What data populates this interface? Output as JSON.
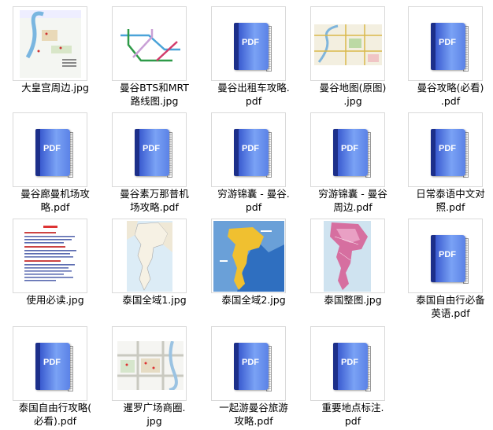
{
  "files": [
    {
      "name": "大皇宫周边.jpg",
      "kind": "image",
      "theme": "map-light"
    },
    {
      "name": "曼谷BTS和MRT\n路线图.jpg",
      "kind": "image",
      "theme": "transit"
    },
    {
      "name": "曼谷出租车攻略.\npdf",
      "kind": "pdf"
    },
    {
      "name": "曼谷地图(原图)\n.jpg",
      "kind": "image",
      "theme": "city-map"
    },
    {
      "name": "曼谷攻略(必看)\n.pdf",
      "kind": "pdf"
    },
    {
      "name": "曼谷廊曼机场攻\n略.pdf",
      "kind": "pdf"
    },
    {
      "name": "曼谷素万那普机\n场攻略.pdf",
      "kind": "pdf"
    },
    {
      "name": "穷游锦囊 - 曼谷.\npdf",
      "kind": "pdf"
    },
    {
      "name": "穷游锦囊 - 曼谷\n周边.pdf",
      "kind": "pdf"
    },
    {
      "name": "日常泰语中文对\n照.pdf",
      "kind": "pdf"
    },
    {
      "name": "使用必读.jpg",
      "kind": "image",
      "theme": "document"
    },
    {
      "name": "泰国全域1.jpg",
      "kind": "image",
      "theme": "country-light"
    },
    {
      "name": "泰国全域2.jpg",
      "kind": "image",
      "theme": "country-blue"
    },
    {
      "name": "泰国整图.jpg",
      "kind": "image",
      "theme": "country-pink"
    },
    {
      "name": "泰国自由行必备\n英语.pdf",
      "kind": "pdf"
    },
    {
      "name": "泰国自由行攻略(\n必看).pdf",
      "kind": "pdf"
    },
    {
      "name": "暹罗广场商圈.\njpg",
      "kind": "image",
      "theme": "street-map"
    },
    {
      "name": "一起游曼谷旅游\n攻略.pdf",
      "kind": "pdf"
    },
    {
      "name": "重要地点标注.\npdf",
      "kind": "pdf"
    }
  ],
  "pdf_badge": "PDF",
  "colors": {
    "pdf_dark": "#1c2f8a",
    "pdf_light": "#7aa2f5",
    "border": "#d9d9d9"
  }
}
